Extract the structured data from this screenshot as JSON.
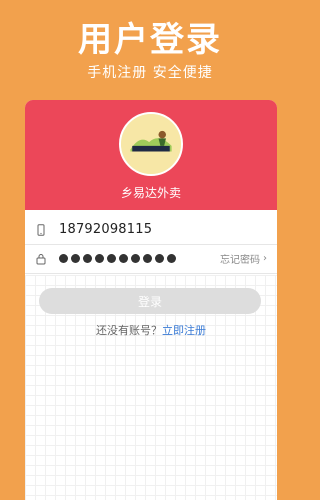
{
  "header": {
    "title": "用户登录",
    "subtitle": "手机注册 安全便捷"
  },
  "card": {
    "brand_name": "乡易达外卖",
    "phone": {
      "value": "18792098115",
      "icon": "phone-icon"
    },
    "password": {
      "dot_count": 10,
      "icon": "lock-icon"
    },
    "forgot_label": "忘记密码",
    "login_label": "登录",
    "register_prompt": "还没有账号？",
    "register_link": "立即注册"
  },
  "colors": {
    "background": "#F2A14D",
    "header_red": "#EC4759",
    "button_disabled": "#dddddd",
    "link_blue": "#3a7bd5"
  }
}
